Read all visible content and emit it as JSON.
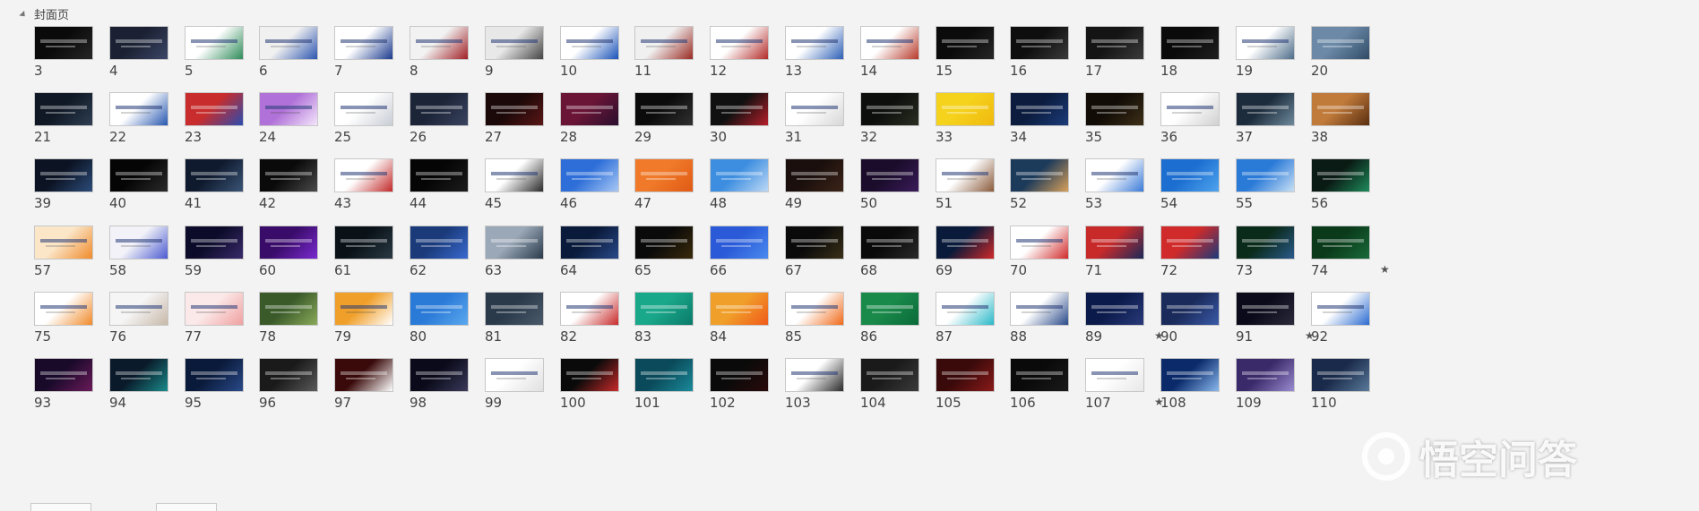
{
  "section": {
    "title": "封面页"
  },
  "watermark": {
    "text": "悟空问答"
  },
  "rows": [
    [
      {
        "n": "3",
        "c1": "#0a0a0a",
        "c2": "#262626",
        "s": "dark"
      },
      {
        "n": "4",
        "c1": "#1b2133",
        "c2": "#3c4666",
        "s": "dark"
      },
      {
        "n": "5",
        "c1": "#ffffff",
        "c2": "#2e8c5a",
        "s": "light"
      },
      {
        "n": "6",
        "c1": "#f0f0f0",
        "c2": "#2d56b0",
        "s": "light"
      },
      {
        "n": "7",
        "c1": "#ffffff",
        "c2": "#1b3a8e",
        "s": "light"
      },
      {
        "n": "8",
        "c1": "#f2f2f2",
        "c2": "#a01f24",
        "s": "light"
      },
      {
        "n": "9",
        "c1": "#e8e8e8",
        "c2": "#444444",
        "s": "light"
      },
      {
        "n": "10",
        "c1": "#ffffff",
        "c2": "#1a52b8",
        "s": "light"
      },
      {
        "n": "11",
        "c1": "#f0f0f0",
        "c2": "#9a2a22",
        "s": "light"
      },
      {
        "n": "12",
        "c1": "#ffffff",
        "c2": "#b22b28",
        "s": "light"
      },
      {
        "n": "13",
        "c1": "#ffffff",
        "c2": "#2c5fb6",
        "s": "light"
      },
      {
        "n": "14",
        "c1": "#ffffff",
        "c2": "#b73a2a",
        "s": "light"
      },
      {
        "n": "15",
        "c1": "#0b0b0b",
        "c2": "#262626",
        "s": "dark"
      },
      {
        "n": "16",
        "c1": "#0e0e0e",
        "c2": "#3a3a3a",
        "s": "dark"
      },
      {
        "n": "17",
        "c1": "#141414",
        "c2": "#3b3b3b",
        "s": "dark"
      },
      {
        "n": "18",
        "c1": "#0a0a0a",
        "c2": "#202020",
        "s": "dark"
      },
      {
        "n": "19",
        "c1": "#ffffff",
        "c2": "#4d6d8a",
        "s": "light"
      },
      {
        "n": "20",
        "c1": "#6c8aa8",
        "c2": "#2f4b66",
        "s": "dark"
      }
    ],
    [
      {
        "n": "21",
        "c1": "#0f1824",
        "c2": "#2e3e52",
        "s": "dark"
      },
      {
        "n": "22",
        "c1": "#ffffff",
        "c2": "#2757b0",
        "s": "light"
      },
      {
        "n": "23",
        "c1": "#c82c2c",
        "c2": "#2a4cb0",
        "s": "dark"
      },
      {
        "n": "24",
        "c1": "#b071d8",
        "c2": "#f3e6fb",
        "s": "light"
      },
      {
        "n": "25",
        "c1": "#ffffff",
        "c2": "#c8ccd4",
        "s": "light"
      },
      {
        "n": "26",
        "c1": "#1c2438",
        "c2": "#3a4460",
        "s": "dark"
      },
      {
        "n": "27",
        "c1": "#1b0808",
        "c2": "#5a1616",
        "s": "dark"
      },
      {
        "n": "28",
        "c1": "#6a1436",
        "c2": "#2a0f2e",
        "s": "dark"
      },
      {
        "n": "29",
        "c1": "#0b0b0b",
        "c2": "#303030",
        "s": "dark"
      },
      {
        "n": "30",
        "c1": "#101010",
        "c2": "#b51f2a",
        "s": "dark"
      },
      {
        "n": "31",
        "c1": "#ffffff",
        "c2": "#d7d7d7",
        "s": "light"
      },
      {
        "n": "32",
        "c1": "#0c0f0c",
        "c2": "#2a2e22",
        "s": "dark"
      },
      {
        "n": "33",
        "c1": "#f5d21c",
        "c2": "#f0b90f",
        "s": "dark"
      },
      {
        "n": "34",
        "c1": "#0b1c3e",
        "c2": "#1c3c7a",
        "s": "dark"
      },
      {
        "n": "35",
        "c1": "#110c06",
        "c2": "#3e2f18",
        "s": "dark"
      },
      {
        "n": "36",
        "c1": "#ffffff",
        "c2": "#d0d0d0",
        "s": "light"
      },
      {
        "n": "37",
        "c1": "#1c2c3c",
        "c2": "#6e8a9c",
        "s": "dark"
      },
      {
        "n": "38",
        "c1": "#c07a3a",
        "c2": "#5a2e10",
        "s": "dark"
      }
    ],
    [
      {
        "n": "39",
        "c1": "#0c1424",
        "c2": "#2c4c7a",
        "s": "dark"
      },
      {
        "n": "40",
        "c1": "#050505",
        "c2": "#2a2a2a",
        "s": "dark"
      },
      {
        "n": "41",
        "c1": "#0f1a2e",
        "c2": "#3a5576",
        "s": "dark"
      },
      {
        "n": "42",
        "c1": "#0a0a0a",
        "c2": "#4a4a4a",
        "s": "dark"
      },
      {
        "n": "43",
        "c1": "#ffffff",
        "c2": "#c22a2a",
        "s": "light"
      },
      {
        "n": "44",
        "c1": "#050505",
        "c2": "#1c1c1c",
        "s": "dark"
      },
      {
        "n": "45",
        "c1": "#ffffff",
        "c2": "#2a2a2a",
        "s": "light"
      },
      {
        "n": "46",
        "c1": "#2d6ed8",
        "c2": "#a8c8f5",
        "s": "dark"
      },
      {
        "n": "47",
        "c1": "#f07a2a",
        "c2": "#e05a14",
        "s": "dark"
      },
      {
        "n": "48",
        "c1": "#3d8ee0",
        "c2": "#bcd8f5",
        "s": "dark"
      },
      {
        "n": "49",
        "c1": "#1a0f0c",
        "c2": "#3c2418",
        "s": "dark"
      },
      {
        "n": "50",
        "c1": "#1a0c2a",
        "c2": "#3a1c5a",
        "s": "dark"
      },
      {
        "n": "51",
        "c1": "#ffffff",
        "c2": "#8a5a3a",
        "s": "light"
      },
      {
        "n": "52",
        "c1": "#1c3a5a",
        "c2": "#d8a05a",
        "s": "dark"
      },
      {
        "n": "53",
        "c1": "#ffffff",
        "c2": "#3a7ad8",
        "s": "light"
      },
      {
        "n": "54",
        "c1": "#1c6ed0",
        "c2": "#4fa4ee",
        "s": "dark"
      },
      {
        "n": "55",
        "c1": "#2a7ad8",
        "c2": "#c8e0f5",
        "s": "dark"
      },
      {
        "n": "56",
        "c1": "#0a1a14",
        "c2": "#1e8a5a",
        "s": "dark"
      }
    ],
    [
      {
        "n": "57",
        "c1": "#fbe6c8",
        "c2": "#f08a2a",
        "s": "light"
      },
      {
        "n": "58",
        "c1": "#f2f2f8",
        "c2": "#4a5ad0",
        "s": "light"
      },
      {
        "n": "59",
        "c1": "#0c0c2a",
        "c2": "#3a2a6a",
        "s": "dark"
      },
      {
        "n": "60",
        "c1": "#3a0c6a",
        "c2": "#7a2ad0",
        "s": "dark"
      },
      {
        "n": "61",
        "c1": "#0a1218",
        "c2": "#2a3a44",
        "s": "dark"
      },
      {
        "n": "62",
        "c1": "#1a3a7a",
        "c2": "#3a6ad0",
        "s": "dark"
      },
      {
        "n": "63",
        "c1": "#9aa8b8",
        "c2": "#2a3a4a",
        "s": "dark"
      },
      {
        "n": "64",
        "c1": "#0a1a3a",
        "c2": "#2a4a8a",
        "s": "dark"
      },
      {
        "n": "65",
        "c1": "#0a0a0a",
        "c2": "#3a2a0a",
        "s": "dark"
      },
      {
        "n": "66",
        "c1": "#2a5ad8",
        "c2": "#4a8aee",
        "s": "dark"
      },
      {
        "n": "67",
        "c1": "#0a0a0a",
        "c2": "#3a3018",
        "s": "dark"
      },
      {
        "n": "68",
        "c1": "#0a0a0a",
        "c2": "#2a2a2a",
        "s": "dark"
      },
      {
        "n": "69",
        "c1": "#0a1a3a",
        "c2": "#d02a2a",
        "s": "dark"
      },
      {
        "n": "70",
        "c1": "#ffffff",
        "c2": "#d02a2a",
        "s": "light"
      },
      {
        "n": "71",
        "c1": "#c82a2a",
        "c2": "#1a2a5a",
        "s": "dark"
      },
      {
        "n": "72",
        "c1": "#d02a2a",
        "c2": "#1a3a7a",
        "s": "dark"
      },
      {
        "n": "73",
        "c1": "#0a2a1a",
        "c2": "#2a5a8a",
        "s": "dark"
      },
      {
        "n": "74",
        "c1": "#0a3a1a",
        "c2": "#1a6a3a",
        "s": "dark",
        "star": true
      }
    ],
    [
      {
        "n": "75",
        "c1": "#ffffff",
        "c2": "#f08a2a",
        "s": "light"
      },
      {
        "n": "76",
        "c1": "#f5f5f5",
        "c2": "#c8b8a8",
        "s": "light"
      },
      {
        "n": "77",
        "c1": "#fbe8e8",
        "c2": "#f0a0a0",
        "s": "light"
      },
      {
        "n": "78",
        "c1": "#3a5a2a",
        "c2": "#8aaa5a",
        "s": "dark"
      },
      {
        "n": "79",
        "c1": "#f0a02a",
        "c2": "#ffffff",
        "s": "light"
      },
      {
        "n": "80",
        "c1": "#2a7ad8",
        "c2": "#5aa8ee",
        "s": "dark"
      },
      {
        "n": "81",
        "c1": "#2a3a4a",
        "c2": "#4a5a6a",
        "s": "dark"
      },
      {
        "n": "82",
        "c1": "#ffffff",
        "c2": "#c82a2a",
        "s": "light"
      },
      {
        "n": "83",
        "c1": "#1aa88a",
        "c2": "#0a7a6a",
        "s": "dark"
      },
      {
        "n": "84",
        "c1": "#f0a02a",
        "c2": "#f05a1a",
        "s": "dark"
      },
      {
        "n": "85",
        "c1": "#ffffff",
        "c2": "#f06a1a",
        "s": "light"
      },
      {
        "n": "86",
        "c1": "#1a8a4a",
        "c2": "#0a6a3a",
        "s": "dark"
      },
      {
        "n": "87",
        "c1": "#ffffff",
        "c2": "#2ab8c8",
        "s": "light"
      },
      {
        "n": "88",
        "c1": "#ffffff",
        "c2": "#2a4a8a",
        "s": "light"
      },
      {
        "n": "89",
        "c1": "#0a1a4a",
        "c2": "#2a3a7a",
        "s": "dark",
        "star": true
      },
      {
        "n": "90",
        "c1": "#1a2a5a",
        "c2": "#3a5aa8",
        "s": "dark"
      },
      {
        "n": "91",
        "c1": "#0a0a1a",
        "c2": "#2a2a3a",
        "s": "dark",
        "star": true
      },
      {
        "n": "92",
        "c1": "#ffffff",
        "c2": "#2a6ad0",
        "s": "light"
      }
    ],
    [
      {
        "n": "93",
        "c1": "#1a0a2a",
        "c2": "#6a1a5a",
        "s": "dark"
      },
      {
        "n": "94",
        "c1": "#0a1a2a",
        "c2": "#1a8a8a",
        "s": "dark"
      },
      {
        "n": "95",
        "c1": "#0a1a3a",
        "c2": "#2a4a8a",
        "s": "dark"
      },
      {
        "n": "96",
        "c1": "#1a1a1a",
        "c2": "#5a5a5a",
        "s": "dark"
      },
      {
        "n": "97",
        "c1": "#3a0a0a",
        "c2": "#ffffff",
        "s": "dark"
      },
      {
        "n": "98",
        "c1": "#0a0a1a",
        "c2": "#3a3a5a",
        "s": "dark"
      },
      {
        "n": "99",
        "c1": "#ffffff",
        "c2": "#e0e0e0",
        "s": "light"
      },
      {
        "n": "100",
        "c1": "#0a0a0a",
        "c2": "#c82a2a",
        "s": "dark"
      },
      {
        "n": "101",
        "c1": "#0a4a5a",
        "c2": "#1a8a9a",
        "s": "dark"
      },
      {
        "n": "102",
        "c1": "#0a0a0a",
        "c2": "#2a0a0a",
        "s": "dark"
      },
      {
        "n": "103",
        "c1": "#ffffff",
        "c2": "#2a2a2a",
        "s": "light"
      },
      {
        "n": "104",
        "c1": "#1a1a1a",
        "c2": "#3a3a3a",
        "s": "dark"
      },
      {
        "n": "105",
        "c1": "#3a0a0a",
        "c2": "#8a1a1a",
        "s": "dark"
      },
      {
        "n": "106",
        "c1": "#0a0a0a",
        "c2": "#1a1a1a",
        "s": "dark"
      },
      {
        "n": "107",
        "c1": "#ffffff",
        "c2": "#e8e8e8",
        "s": "light",
        "star": true
      },
      {
        "n": "108",
        "c1": "#0a2a6a",
        "c2": "#8ab8ee",
        "s": "dark"
      },
      {
        "n": "109",
        "c1": "#3a2a6a",
        "c2": "#9a8ad0",
        "s": "dark"
      },
      {
        "n": "110",
        "c1": "#1a2a4a",
        "c2": "#5a7a9a",
        "s": "dark"
      }
    ]
  ]
}
